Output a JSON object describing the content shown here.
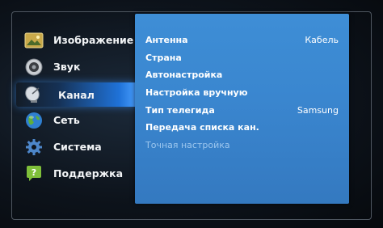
{
  "sidebar": {
    "items": [
      {
        "label": "Изображение",
        "icon": "picture-icon"
      },
      {
        "label": "Звук",
        "icon": "speaker-icon"
      },
      {
        "label": "Канал",
        "icon": "satellite-dish-icon",
        "active": true
      },
      {
        "label": "Сеть",
        "icon": "globe-icon"
      },
      {
        "label": "Система",
        "icon": "gear-icon"
      },
      {
        "label": "Поддержка",
        "icon": "help-icon"
      }
    ]
  },
  "channel_menu": {
    "rows": [
      {
        "label": "Антенна",
        "value": "Кабель"
      },
      {
        "label": "Страна",
        "value": ""
      },
      {
        "label": "Автонастройка",
        "value": ""
      },
      {
        "label": "Настройка вручную",
        "value": ""
      },
      {
        "label": "Тип телегида",
        "value": "Samsung"
      },
      {
        "label": "Передача списка кан.",
        "value": ""
      },
      {
        "label": "Точная настройка",
        "value": "",
        "disabled": true
      }
    ]
  },
  "colors": {
    "panel": "#3a86cf",
    "highlight": "#1f72d8",
    "disabled_text": "#9cc6ee"
  }
}
